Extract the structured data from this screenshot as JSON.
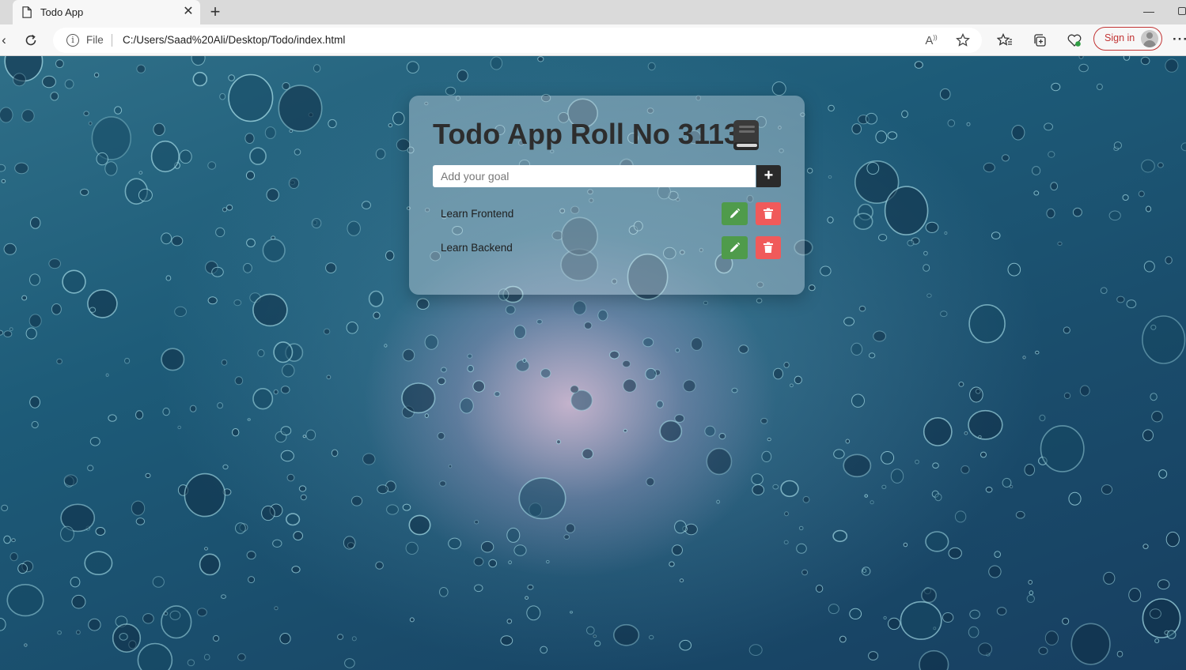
{
  "browser": {
    "tab_title": "Todo App",
    "url_scheme": "File",
    "url": "C:/Users/Saad%20Ali/Desktop/Todo/index.html",
    "signin_label": "Sign in",
    "icons": [
      "page-icon",
      "close-icon",
      "new-tab-icon",
      "minimize-icon",
      "restore-icon",
      "refresh-icon",
      "info-icon",
      "read-aloud-icon",
      "favorite-star-icon",
      "favorites-icon",
      "collections-icon",
      "browser-essentials-icon",
      "avatar",
      "more-icon"
    ]
  },
  "todo": {
    "title": "Todo App Roll No 3113",
    "input_placeholder": "Add your goal",
    "add_label": "+",
    "items": [
      {
        "text": "Learn Frontend"
      },
      {
        "text": "Learn Backend"
      }
    ],
    "colors": {
      "edit": "#4f9b4b",
      "delete": "#f05a5a",
      "add": "#2a2a2a"
    }
  }
}
